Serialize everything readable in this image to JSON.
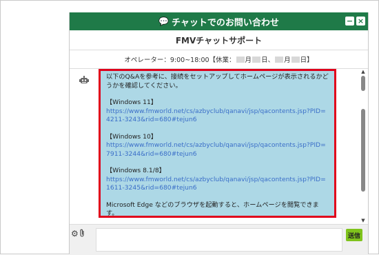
{
  "window": {
    "title": "チャットでのお問い合わせ",
    "minimize_label": "−",
    "close_label": "×"
  },
  "header": {
    "subtitle": "FMVチャットサポート",
    "hours_prefix": "オペレーター：9:00~18:00【休業：",
    "hours_month1": "月",
    "hours_day1": "日、",
    "hours_month2": "月",
    "hours_day2": "日】"
  },
  "message": {
    "intro": "以下のQ&Aを参考に、接続をセットアップしてホームページが表示されるかどうかを確認してください。",
    "sections": [
      {
        "title": "【Windows 11】",
        "link": "https://www.fmworld.net/cs/azbyclub/qanavi/jsp/qacontents.jsp?PID=4211-3243&rid=680#tejun6"
      },
      {
        "title": "【Windows 10】",
        "link": "https://www.fmworld.net/cs/azbyclub/qanavi/jsp/qacontents.jsp?PID=7911-3244&rid=680#tejun6"
      },
      {
        "title": "【Windows 8.1/8】",
        "link": "https://www.fmworld.net/cs/azbyclub/qanavi/jsp/qacontents.jsp?PID=1611-3245&rid=680#tejun6"
      }
    ],
    "outro": "Microsoft Edge などのブラウザを起動すると、ホームページを閲覧できます。"
  },
  "input": {
    "send_label": "送信",
    "placeholder": ""
  },
  "icons": {
    "chat": "chat-bubble-icon",
    "bot": "robot-icon",
    "settings": "gear-icon",
    "attach": "paperclip-icon"
  },
  "colors": {
    "header_bg": "#1f7a48",
    "bubble_bg": "#add8e6",
    "highlight_border": "#e0001b",
    "send_bg": "#7fc31c",
    "link": "#3a6ec8"
  }
}
